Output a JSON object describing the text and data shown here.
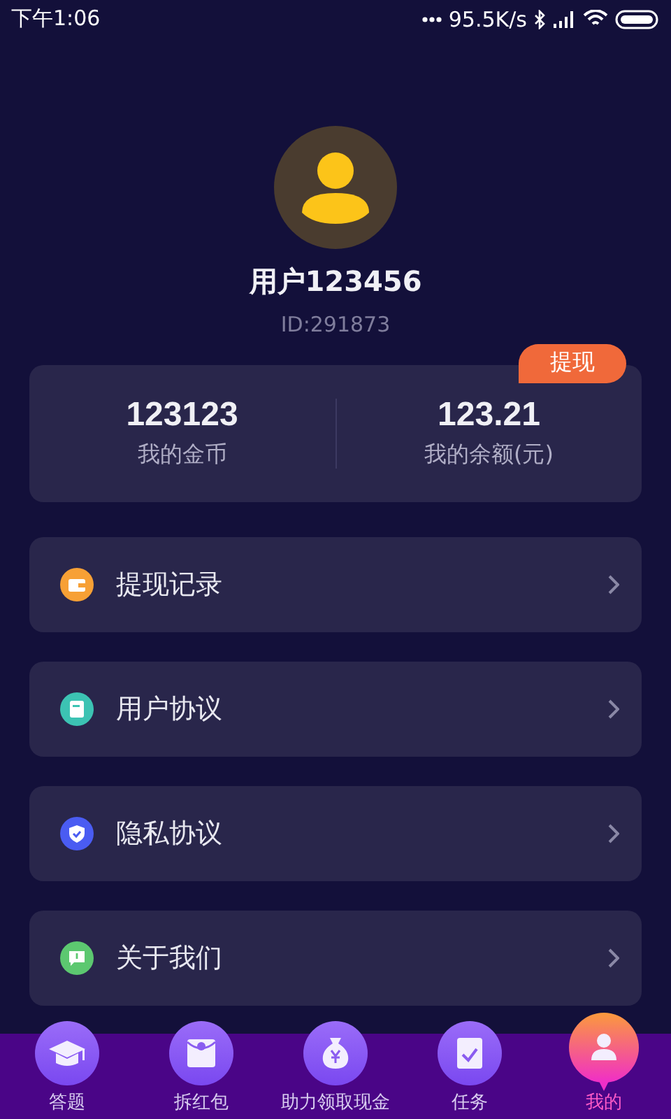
{
  "status_bar": {
    "time": "下午1:06",
    "speed": "95.5K/s"
  },
  "profile": {
    "name": "用户123456",
    "id": "ID:291873"
  },
  "stats": {
    "withdraw_button": "提现",
    "items": [
      {
        "value": "123123",
        "label": "我的金币"
      },
      {
        "value": "123.21",
        "label": "我的余额(元)"
      }
    ]
  },
  "menu": [
    {
      "kind": "wallet",
      "color": "#f7a035",
      "label": "提现记录"
    },
    {
      "kind": "document",
      "color": "#3cc3b3",
      "label": "用户协议"
    },
    {
      "kind": "shield",
      "color": "#4a5cf2",
      "label": "隐私协议"
    },
    {
      "kind": "chat",
      "color": "#5cc870",
      "label": "关于我们"
    }
  ],
  "tabs": [
    {
      "kind": "cap",
      "label": "答题",
      "selected": false
    },
    {
      "kind": "envelope",
      "label": "拆红包",
      "selected": false
    },
    {
      "kind": "moneybag",
      "label": "助力领取现金",
      "selected": false
    },
    {
      "kind": "task",
      "label": "任务",
      "selected": false
    },
    {
      "kind": "user",
      "label": "我的",
      "selected": true
    }
  ]
}
